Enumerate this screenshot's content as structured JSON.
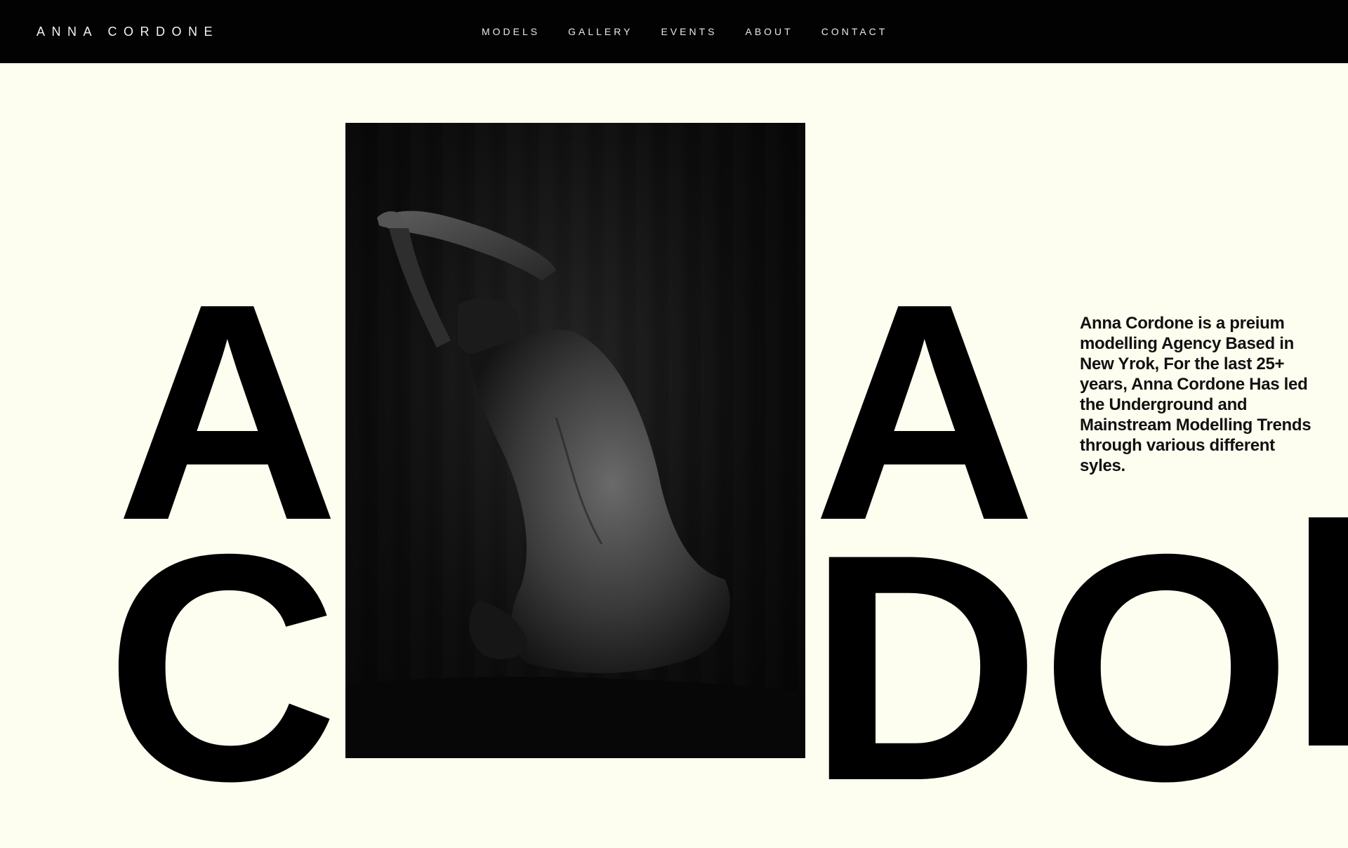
{
  "header": {
    "brand": "ANNA CORDONE",
    "nav": [
      "MODELS",
      "GALLERY",
      "EVENTS",
      "ABOUT",
      "CONTACT"
    ]
  },
  "hero": {
    "letters_left": [
      "A",
      "C"
    ],
    "letters_right_top": "A",
    "letters_right_bottom": "DO"
  },
  "about": {
    "text": "Anna Cordone is a preium modelling Agency Based in New Yrok, For the last 25+ years, Anna Cordone Has led the Underground and Mainstream Modelling Trends through various different syles."
  },
  "colors": {
    "background": "#fdfeef",
    "nav_background": "#020202",
    "text": "#000000"
  }
}
